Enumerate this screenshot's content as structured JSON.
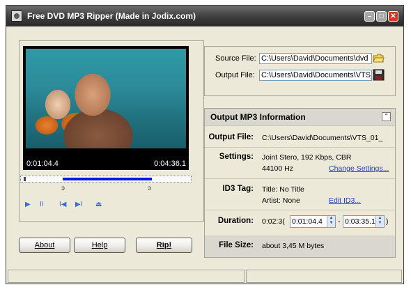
{
  "window": {
    "title": "Free DVD MP3 Ripper   (Made in Jodix.com)"
  },
  "player": {
    "time_current": "0:01:04.4",
    "time_total": "0:04:36.1",
    "controls": [
      "▶",
      "II",
      "I◀",
      "▶I",
      "⏏"
    ]
  },
  "files": {
    "source_label": "Source File:",
    "source_value": "C:\\Users\\David\\Documents\\dvd",
    "output_label": "Output File:",
    "output_value": "C:\\Users\\David\\Documents\\VTS_"
  },
  "info": {
    "header": "Output MP3 Information",
    "output_file_label": "Output File:",
    "output_file_value": "C:\\Users\\David\\Documents\\VTS_01_",
    "settings_label": "Settings:",
    "settings_line1": "Joint Stero, 192 Kbps, CBR",
    "settings_line2": "44100 Hz",
    "change_settings_link": "Change Settings...",
    "id3_label": "ID3 Tag:",
    "id3_title": "Title: No Title",
    "id3_artist": "Artist: None",
    "edit_id3_link": "Edit ID3...",
    "duration_label": "Duration:",
    "duration_value": "0:02:3(",
    "duration_start": "0:01:04.4",
    "duration_sep": "-",
    "duration_end": "0:03:35.1",
    "duration_close": ")",
    "filesize_label": "File Size:",
    "filesize_value": "about 3,45 M bytes"
  },
  "buttons": {
    "about": "About",
    "help": "Help",
    "rip": "Rip!"
  },
  "colors": {
    "accent_link": "#1a3ec4",
    "selection": "#0018e0",
    "close": "#d23b22"
  }
}
